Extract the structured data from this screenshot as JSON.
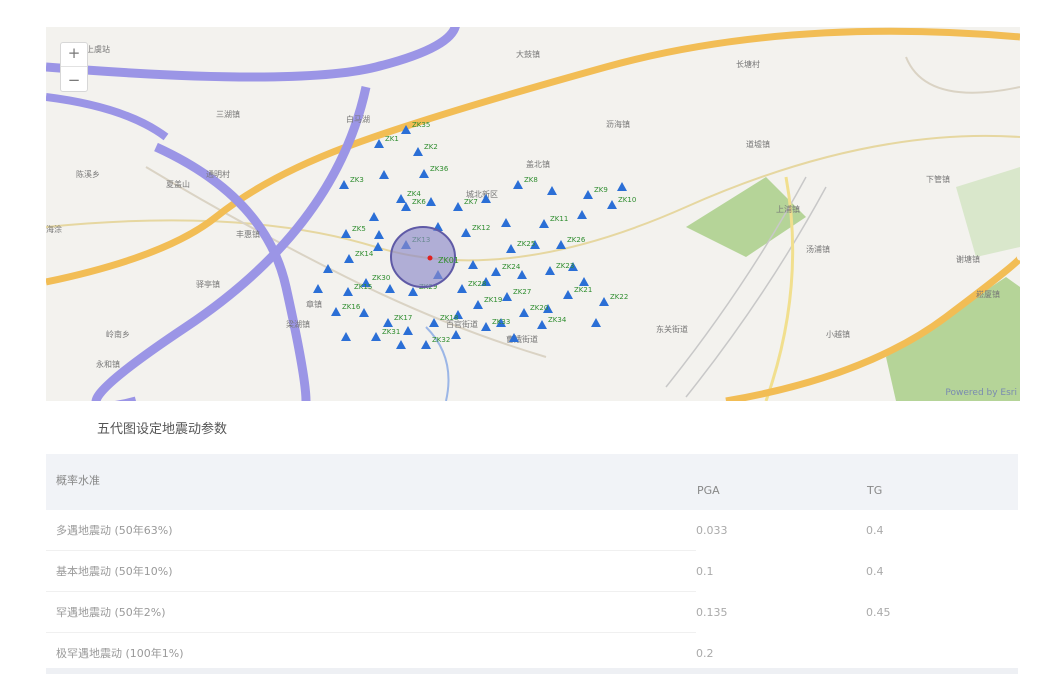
{
  "map": {
    "zoom_in": "+",
    "zoom_out": "−",
    "attribution": "Powered by Esri",
    "circle_label": "ZK01",
    "place_labels": [
      "上虞站",
      "三湖镇",
      "白马湖",
      "大鼓镇",
      "长塘村",
      "通明村",
      "城北新区",
      "沥海镇",
      "盖北镇",
      "海涂",
      "丰惠镇",
      "章镇",
      "岭南乡",
      "永和镇",
      "驿亭镇",
      "梁湖镇",
      "百官街道",
      "曹娥街道",
      "东关街道",
      "道墟镇",
      "上浦镇",
      "汤浦镇",
      "下管镇",
      "谢塘镇",
      "崧厦镇",
      "小越镇",
      "陈溪乡",
      "夏盖山"
    ],
    "borehole_labels": [
      "ZK1",
      "ZK2",
      "ZK3",
      "ZK4",
      "ZK5",
      "ZK6",
      "ZK7",
      "ZK8",
      "ZK9",
      "ZK10",
      "ZK11",
      "ZK12",
      "ZK13",
      "ZK14",
      "ZK15",
      "ZK16",
      "ZK17",
      "ZK18",
      "ZK19",
      "ZK20",
      "ZK21",
      "ZK22",
      "ZK23",
      "ZK24",
      "ZK25",
      "ZK26",
      "ZK27",
      "ZK28",
      "ZK29",
      "ZK30",
      "ZK31",
      "ZK32",
      "ZK33",
      "ZK34",
      "ZK35",
      "ZK36"
    ]
  },
  "section": {
    "title": "五代图设定地震动参数"
  },
  "table": {
    "headers": {
      "c1": "概率水准",
      "c2": "PGA",
      "c3": "TG"
    },
    "rows": [
      {
        "c1": "多遇地震动 (50年63%)",
        "c2": "0.033",
        "c3": "0.4"
      },
      {
        "c1": "基本地震动 (50年10%)",
        "c2": "0.1",
        "c3": "0.4"
      },
      {
        "c1": "罕遇地震动 (50年2%)",
        "c2": "0.135",
        "c3": "0.45"
      },
      {
        "c1": "极罕遇地震动 (100年1%)",
        "c2": "0.2",
        "c3": ""
      }
    ]
  },
  "colors": {
    "road_major": "#9b95e6",
    "road_orange": "#f2bd55",
    "green": "#a7cf86",
    "triangle": "#2b6fd6",
    "label_green": "#2f8d2f",
    "circle_fill": "#8c89c9"
  }
}
